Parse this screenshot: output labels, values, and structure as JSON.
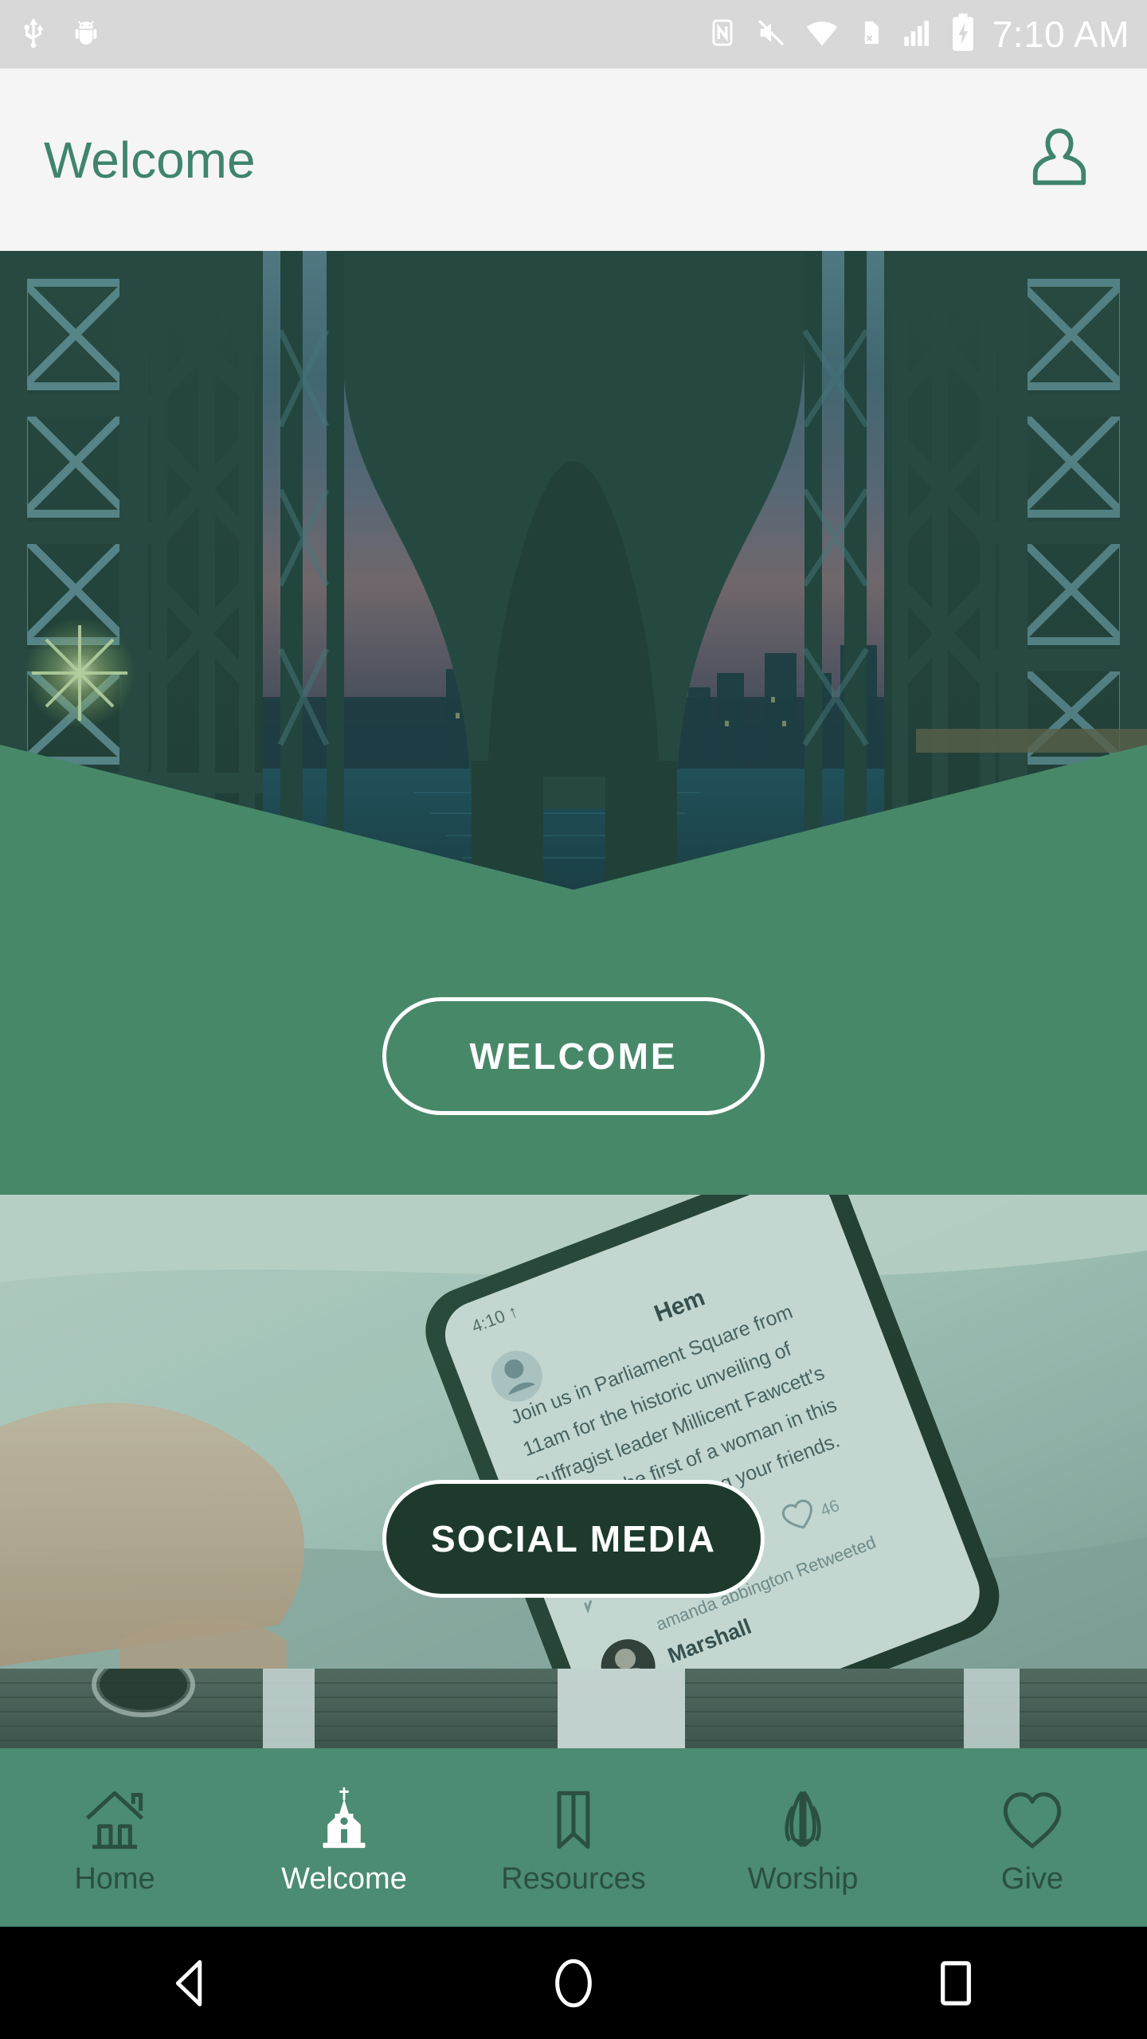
{
  "status_bar": {
    "time": "7:10 AM",
    "left_icons": [
      "usb-icon",
      "android-debug-icon"
    ],
    "right_icons": [
      "nfc-icon",
      "mute-icon",
      "wifi-icon",
      "no-sim-icon",
      "signal-icon",
      "battery-charging-icon"
    ],
    "background": "#d8d8d8"
  },
  "app_bar": {
    "title": "Welcome",
    "profile_icon": "person-icon",
    "background": "#f5f5f5",
    "title_color": "#3f846e"
  },
  "hero": {
    "alt": "bridge-photo",
    "overlay_color": "#478869"
  },
  "welcome_section": {
    "button_label": "WELCOME",
    "background": "#478869",
    "border_color": "#ffffff"
  },
  "social_section": {
    "button_label": "SOCIAL MEDIA",
    "alt": "hand-holding-phone-photo",
    "button_fill": "#1d3a2c",
    "border_color": "#ffffff"
  },
  "third_section": {
    "alt": "wooden-table-photo"
  },
  "bottom_nav": {
    "background": "#4b8c73",
    "active_color": "#ffffff",
    "inactive_color": "#2b5040",
    "items": [
      {
        "label": "Home",
        "icon": "home-icon",
        "active": false
      },
      {
        "label": "Welcome",
        "icon": "church-icon",
        "active": true
      },
      {
        "label": "Resources",
        "icon": "bookmark-icon",
        "active": false
      },
      {
        "label": "Worship",
        "icon": "praying-hands-icon",
        "active": false
      },
      {
        "label": "Give",
        "icon": "heart-icon",
        "active": false
      }
    ]
  },
  "system_nav": {
    "background": "#000000",
    "buttons": [
      "back-button",
      "home-button",
      "recents-button"
    ]
  }
}
